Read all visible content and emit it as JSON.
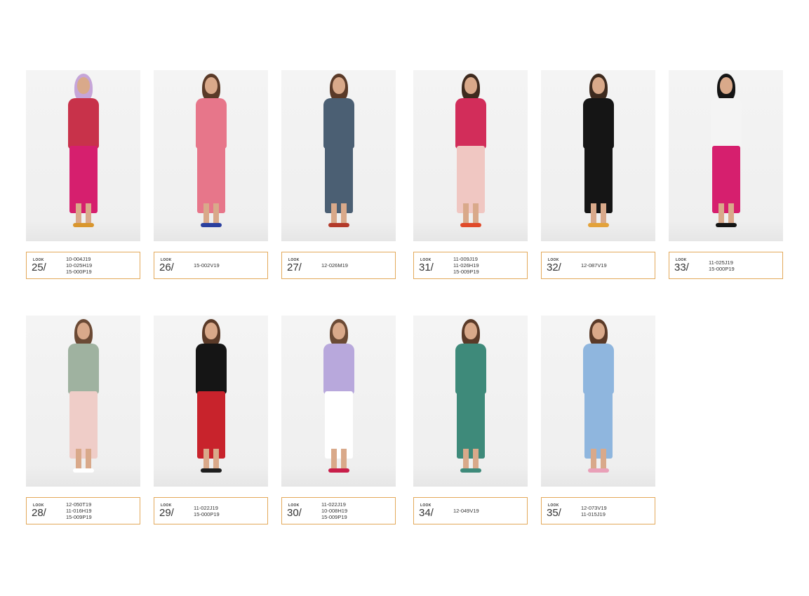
{
  "looks": [
    {
      "label": "LOOK",
      "number": "25/",
      "codes": [
        "10-004J19",
        "10-025H19",
        "15-000P19"
      ],
      "top_color": "#c8324a",
      "bottom_color": "#d61f6e",
      "shoe_color": "#d9962e",
      "hair_color": "#c6a5d8"
    },
    {
      "label": "LOOK",
      "number": "26/",
      "codes": [
        "15-002V19"
      ],
      "top_color": "#e7768a",
      "bottom_color": "#e7768a",
      "shoe_color": "#2a3f9e",
      "hair_color": "#5a3a28"
    },
    {
      "label": "LOOK",
      "number": "27/",
      "codes": [
        "12-026M19"
      ],
      "top_color": "#4b5f73",
      "bottom_color": "#4b5f73",
      "shoe_color": "#b33a2a",
      "hair_color": "#5a3a28"
    },
    {
      "label": "LOOK",
      "number": "31/",
      "codes": [
        "11-009J19",
        "11-026H19",
        "15-009P19"
      ],
      "top_color": "#d22d5a",
      "bottom_color": "#f0c7c2",
      "shoe_color": "#e04a2a",
      "hair_color": "#3e2a1e"
    },
    {
      "label": "LOOK",
      "number": "32/",
      "codes": [
        "12-087V19"
      ],
      "top_color": "#151515",
      "bottom_color": "#151515",
      "shoe_color": "#e3a23a",
      "hair_color": "#3e2a1e"
    },
    {
      "label": "LOOK",
      "number": "33/",
      "codes": [
        "11-025J19",
        "15-000P19"
      ],
      "top_color": "#f4f4f4",
      "bottom_color": "#d61f6e",
      "shoe_color": "#151515",
      "hair_color": "#151515"
    },
    {
      "label": "LOOK",
      "number": "28/",
      "codes": [
        "12-050T19",
        "11-016H19",
        "15-009P19"
      ],
      "top_color": "#9fb2a0",
      "bottom_color": "#efcdc8",
      "shoe_color": "#ffffff",
      "hair_color": "#6b4a35"
    },
    {
      "label": "LOOK",
      "number": "29/",
      "codes": [
        "11-022J19",
        "15-000P19"
      ],
      "top_color": "#151515",
      "bottom_color": "#c8232c",
      "shoe_color": "#1e1e1e",
      "hair_color": "#5a3a28"
    },
    {
      "label": "LOOK",
      "number": "30/",
      "codes": [
        "11-022J19",
        "10-008H19",
        "15-009P19"
      ],
      "top_color": "#b8a8dc",
      "bottom_color": "#ffffff",
      "shoe_color": "#c81e4a",
      "hair_color": "#6b4a35"
    },
    {
      "label": "LOOK",
      "number": "34/",
      "codes": [
        "12-049V19"
      ],
      "top_color": "#3e8a7a",
      "bottom_color": "#3e8a7a",
      "shoe_color": "#3e8a7a",
      "hair_color": "#5a3a28"
    },
    {
      "label": "LOOK",
      "number": "35/",
      "codes": [
        "12-073V19",
        "11-015J19"
      ],
      "top_color": "#8fb6de",
      "bottom_color": "#8fb6de",
      "shoe_color": "#e9a0b8",
      "hair_color": "#5a3a28"
    }
  ]
}
